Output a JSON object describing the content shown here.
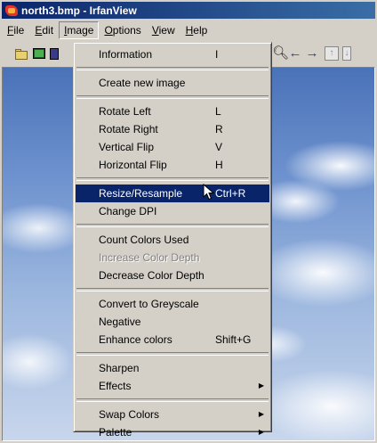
{
  "window": {
    "title": "north3.bmp - IrfanView"
  },
  "menubar": {
    "file": "File",
    "edit": "Edit",
    "image": "Image",
    "options": "Options",
    "view": "View",
    "help": "Help"
  },
  "toolbar": {
    "icons": [
      "open-folder-icon",
      "slideshow-icon",
      "save-icon",
      "zoom-icon",
      "back-arrow-icon",
      "forward-arrow-icon",
      "up-icon",
      "down-icon"
    ]
  },
  "menu": {
    "information": {
      "label": "Information",
      "shortcut": "I"
    },
    "create_new_image": {
      "label": "Create new image"
    },
    "rotate_left": {
      "label": "Rotate Left",
      "shortcut": "L"
    },
    "rotate_right": {
      "label": "Rotate Right",
      "shortcut": "R"
    },
    "vertical_flip": {
      "label": "Vertical Flip",
      "shortcut": "V"
    },
    "horizontal_flip": {
      "label": "Horizontal Flip",
      "shortcut": "H"
    },
    "resize_resample": {
      "label": "Resize/Resample",
      "shortcut": "Ctrl+R"
    },
    "change_dpi": {
      "label": "Change DPI"
    },
    "count_colors": {
      "label": "Count Colors Used"
    },
    "increase_depth": {
      "label": "Increase Color Depth"
    },
    "decrease_depth": {
      "label": "Decrease Color Depth"
    },
    "greyscale": {
      "label": "Convert to Greyscale"
    },
    "negative": {
      "label": "Negative"
    },
    "enhance_colors": {
      "label": "Enhance colors",
      "shortcut": "Shift+G"
    },
    "sharpen": {
      "label": "Sharpen"
    },
    "effects": {
      "label": "Effects"
    },
    "swap_colors": {
      "label": "Swap Colors"
    },
    "palette": {
      "label": "Palette"
    }
  },
  "colors": {
    "highlight": "#0a246a",
    "menu_bg": "#d4d0c8",
    "title_start": "#0a246a",
    "title_end": "#3a6ea5"
  }
}
